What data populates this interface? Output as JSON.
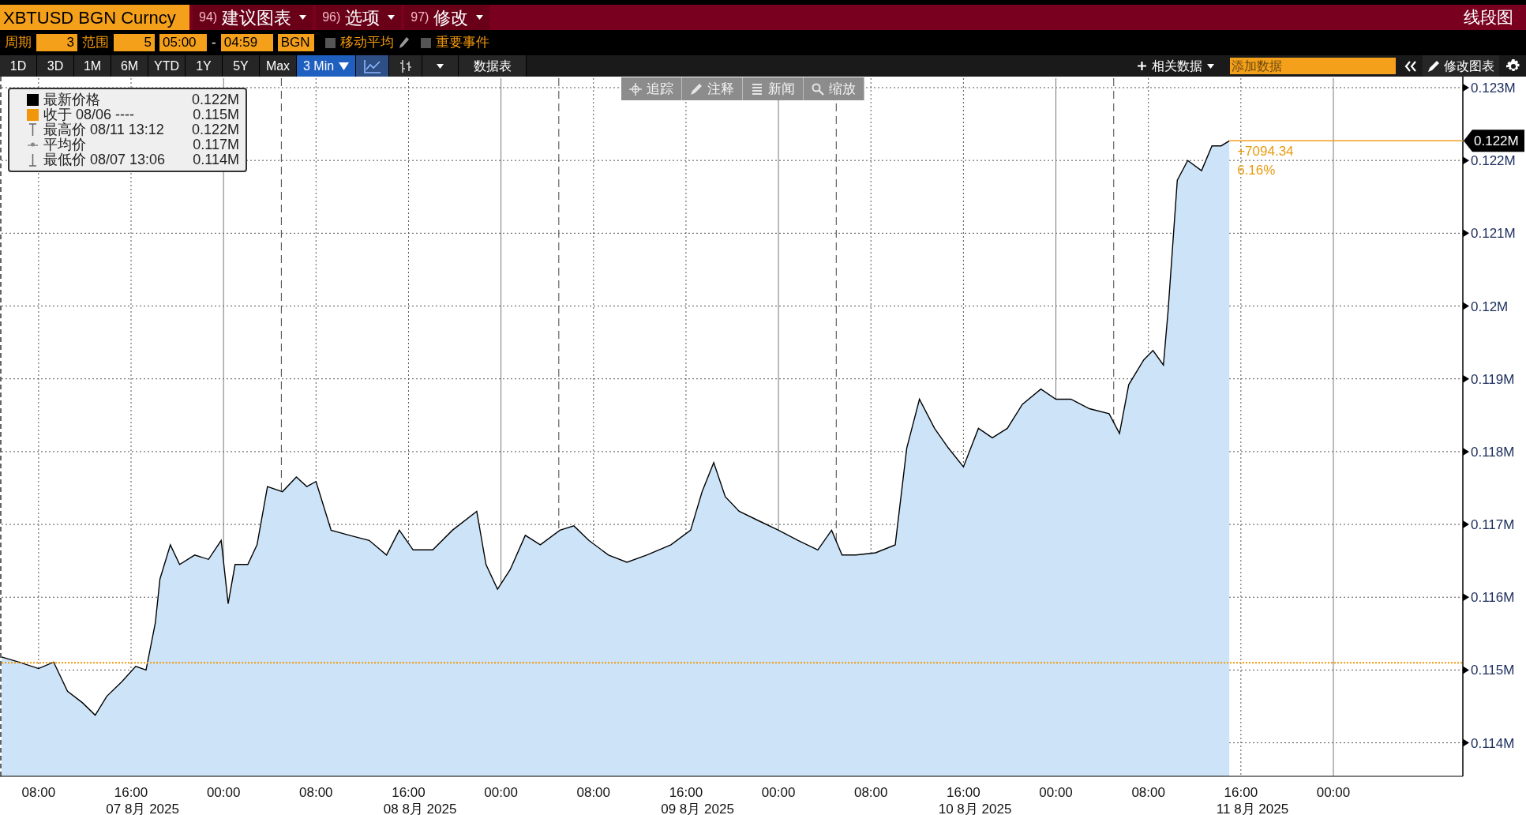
{
  "header": {
    "security": "XBTUSD BGN Curncy",
    "menus": [
      {
        "number": "94)",
        "label": "建议图表"
      },
      {
        "number": "96)",
        "label": "选项"
      },
      {
        "number": "97)",
        "label": "修改"
      }
    ],
    "title": "线段图"
  },
  "settings": {
    "period_label": "周期",
    "period": "3",
    "range_label": "范围",
    "range": "5",
    "start": "05:00",
    "separator": "-",
    "end": "04:59",
    "source": "BGN",
    "options": [
      {
        "label": "移动平均",
        "checked": false,
        "editable": true
      },
      {
        "label": "重要事件",
        "checked": false,
        "editable": false
      }
    ]
  },
  "toolbar": {
    "ranges": [
      {
        "label": "1D",
        "selected": false
      },
      {
        "label": "3D",
        "selected": false
      },
      {
        "label": "1M",
        "selected": false
      },
      {
        "label": "6M",
        "selected": false
      },
      {
        "label": "YTD",
        "selected": false
      },
      {
        "label": "1Y",
        "selected": false
      },
      {
        "label": "5Y",
        "selected": false
      },
      {
        "label": "Max",
        "selected": false
      }
    ],
    "interval": "3 Min",
    "chart_types": [
      {
        "kind": "line",
        "selected": true
      },
      {
        "kind": "bar",
        "selected": false
      }
    ],
    "data_table": "数据表",
    "related": "相关数据",
    "add_data": {
      "placeholder": "添加数据"
    },
    "edit_chart": "修改图表"
  },
  "chart_tools": [
    {
      "kind": "crosshair",
      "label": "追踪",
      "disabled": true
    },
    {
      "kind": "pen",
      "label": "注释",
      "disabled": true
    },
    {
      "kind": "news",
      "label": "新闻",
      "disabled": true
    },
    {
      "kind": "zoom",
      "label": "缩放",
      "disabled": true
    }
  ],
  "legend": [
    {
      "kind": "swatch",
      "color": "#000000",
      "label": "最新价格",
      "value": "0.122M"
    },
    {
      "kind": "swatch",
      "color": "#f0960a",
      "label": "收于 08/06 ----",
      "value": "0.115M"
    },
    {
      "kind": "high",
      "label": "最高价 08/11 13:12",
      "value": "0.122M"
    },
    {
      "kind": "average",
      "label": "平均价",
      "value": "0.117M"
    },
    {
      "kind": "low",
      "label": "最低价 08/07 13:06",
      "value": "0.114M"
    }
  ],
  "chart": {
    "chart_data": {
      "type": "area",
      "grid": true,
      "xlim": [
        "2025-08-07 04:48",
        "2025-08-12 11:12"
      ],
      "ylim": [
        113540,
        123130
      ],
      "xticks": [
        {
          "value": "2025-08-07 08:00",
          "label": "08:00"
        },
        {
          "value": "2025-08-07 16:00",
          "label": "16:00"
        },
        {
          "value": "2025-08-08 00:00",
          "label": "00:00"
        },
        {
          "value": "2025-08-08 08:00",
          "label": "08:00"
        },
        {
          "value": "2025-08-08 16:00",
          "label": "16:00"
        },
        {
          "value": "2025-08-09 00:00",
          "label": "00:00"
        },
        {
          "value": "2025-08-09 08:00",
          "label": "08:00"
        },
        {
          "value": "2025-08-09 16:00",
          "label": "16:00"
        },
        {
          "value": "2025-08-10 00:00",
          "label": "00:00"
        },
        {
          "value": "2025-08-10 08:00",
          "label": "08:00"
        },
        {
          "value": "2025-08-10 16:00",
          "label": "16:00"
        },
        {
          "value": "2025-08-11 00:00",
          "label": "00:00"
        },
        {
          "value": "2025-08-11 08:00",
          "label": "08:00"
        },
        {
          "value": "2025-08-11 16:00",
          "label": "16:00"
        },
        {
          "value": "2025-08-12 00:00",
          "label": "00:00"
        }
      ],
      "yticks": [
        {
          "value": 114000,
          "label": "0.114M"
        },
        {
          "value": 115000,
          "label": "0.115M"
        },
        {
          "value": 116000,
          "label": "0.116M"
        },
        {
          "value": 117000,
          "label": "0.117M"
        },
        {
          "value": 118000,
          "label": "0.118M"
        },
        {
          "value": 119000,
          "label": "0.119M"
        },
        {
          "value": 120000,
          "label": "0.12M"
        },
        {
          "value": 121000,
          "label": "0.121M"
        },
        {
          "value": 122000,
          "label": "0.122M"
        },
        {
          "value": 123000,
          "label": "0.123M"
        }
      ],
      "x": [
        "2025-08-07 04:48",
        "2025-08-07 06:18",
        "2025-08-07 08:00",
        "2025-08-07 09:18",
        "2025-08-07 10:30",
        "2025-08-07 11:48",
        "2025-08-07 12:54",
        "2025-08-07 13:54",
        "2025-08-07 15:12",
        "2025-08-07 16:24",
        "2025-08-07 17:18",
        "2025-08-07 18:06",
        "2025-08-07 18:30",
        "2025-08-07 19:24",
        "2025-08-07 20:12",
        "2025-08-07 21:30",
        "2025-08-07 22:42",
        "2025-08-07 23:48",
        "2025-08-08 00:24",
        "2025-08-08 01:00",
        "2025-08-08 02:06",
        "2025-08-08 02:54",
        "2025-08-08 03:48",
        "2025-08-08 05:06",
        "2025-08-08 06:18",
        "2025-08-08 07:12",
        "2025-08-08 08:00",
        "2025-08-08 09:18",
        "2025-08-08 10:54",
        "2025-08-08 12:36",
        "2025-08-08 14:06",
        "2025-08-08 15:12",
        "2025-08-08 16:24",
        "2025-08-08 18:06",
        "2025-08-08 19:48",
        "2025-08-08 21:54",
        "2025-08-08 22:42",
        "2025-08-08 23:42",
        "2025-08-09 00:48",
        "2025-08-09 02:06",
        "2025-08-09 03:24",
        "2025-08-09 05:06",
        "2025-08-09 06:18",
        "2025-08-09 07:36",
        "2025-08-09 09:18",
        "2025-08-09 10:54",
        "2025-08-09 12:36",
        "2025-08-09 14:42",
        "2025-08-09 16:24",
        "2025-08-09 17:24",
        "2025-08-09 18:24",
        "2025-08-09 19:24",
        "2025-08-09 20:36",
        "2025-08-09 22:18",
        "2025-08-10 00:00",
        "2025-08-10 01:42",
        "2025-08-10 03:24",
        "2025-08-10 04:36",
        "2025-08-10 05:30",
        "2025-08-10 06:42",
        "2025-08-10 08:24",
        "2025-08-10 10:06",
        "2025-08-10 11:06",
        "2025-08-10 12:12",
        "2025-08-10 13:30",
        "2025-08-10 14:42",
        "2025-08-10 16:00",
        "2025-08-10 17:18",
        "2025-08-10 18:30",
        "2025-08-10 19:48",
        "2025-08-10 21:06",
        "2025-08-10 22:42",
        "2025-08-11 00:00",
        "2025-08-11 01:18",
        "2025-08-11 02:54",
        "2025-08-11 04:36",
        "2025-08-11 05:30",
        "2025-08-11 06:18",
        "2025-08-11 07:36",
        "2025-08-11 08:24",
        "2025-08-11 09:18",
        "2025-08-11 09:42",
        "2025-08-11 10:30",
        "2025-08-11 11:24",
        "2025-08-11 12:36",
        "2025-08-11 13:30",
        "2025-08-11 14:18",
        "2025-08-11 15:00"
      ],
      "series": [
        {
          "color": "#000000",
          "values": [
            115180,
            115110,
            115020,
            115110,
            114710,
            114550,
            114380,
            114640,
            114840,
            115050,
            115000,
            115650,
            116250,
            116720,
            116450,
            116580,
            116520,
            116780,
            115910,
            116450,
            116450,
            116720,
            117520,
            117450,
            117650,
            117520,
            117590,
            116920,
            116850,
            116780,
            116580,
            116920,
            116650,
            116650,
            116920,
            117180,
            116450,
            116110,
            116380,
            116850,
            116720,
            116920,
            116980,
            116780,
            116580,
            116480,
            116580,
            116720,
            116920,
            117450,
            117850,
            117380,
            117180,
            117050,
            116920,
            116780,
            116650,
            116920,
            116580,
            116580,
            116610,
            116720,
            118050,
            118720,
            118320,
            118050,
            117790,
            118320,
            118190,
            118320,
            118650,
            118860,
            118720,
            118720,
            118590,
            118520,
            118250,
            118920,
            119260,
            119390,
            119190,
            119930,
            121730,
            122000,
            121860,
            122200,
            122200,
            122270
          ]
        }
      ],
      "ref_lines": [
        {
          "axis": "y",
          "value": 115100,
          "color": "#f0960a"
        }
      ],
      "annotations": [
        "0.122M",
        "+7094.34",
        "6.16%"
      ]
    },
    "date_labels": [
      "07 8月 2025",
      "08 8月 2025",
      "09 8月 2025",
      "10 8月 2025",
      "11 8月 2025"
    ]
  }
}
